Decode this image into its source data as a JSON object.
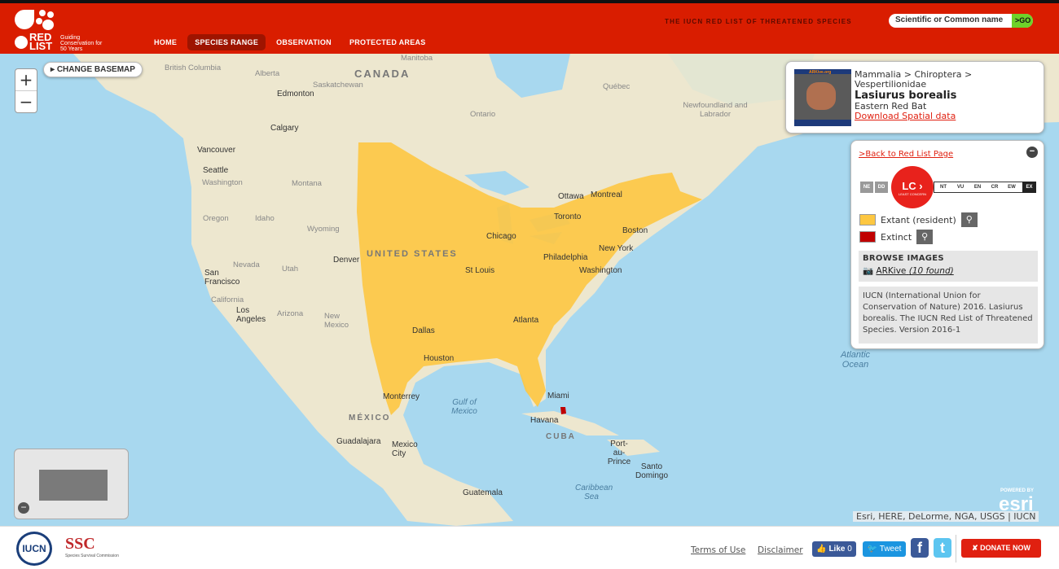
{
  "header": {
    "logo_text": "RED LIST",
    "logo_tagline": "Guiding Conservation for 50 Years",
    "nav": [
      {
        "label": "HOME"
      },
      {
        "label": "SPECIES RANGE",
        "active": true
      },
      {
        "label": "OBSERVATION"
      },
      {
        "label": "PROTECTED AREAS"
      }
    ],
    "tagline": "THE IUCN RED LIST OF THREATENED SPECIES",
    "search": {
      "placeholder": "Scientific or Common name",
      "go": ">GO"
    }
  },
  "map": {
    "change_basemap": "CHANGE BASEMAP",
    "zoom_in": "+",
    "zoom_out": "−",
    "range_color": "#fdc741",
    "extinct_color": "#c00000",
    "ocean_color": "#a8d8ef",
    "land_color": "#ede7cf",
    "labels": [
      "CANADA",
      "UNITED STATES",
      "MÉXICO",
      "CUBA",
      "British Columbia",
      "Alberta",
      "Saskatchewan",
      "Manitoba",
      "Ontario",
      "Québec",
      "Newfoundland and Labrador",
      "Edmonton",
      "Calgary",
      "Vancouver",
      "Seattle",
      "Washington",
      "Montana",
      "Oregon",
      "Idaho",
      "Wyoming",
      "Nevada",
      "Utah",
      "Denver",
      "San Francisco",
      "California",
      "Los Angeles",
      "Arizona",
      "New Mexico",
      "Dallas",
      "Houston",
      "Monterrey",
      "Guadalajara",
      "Mexico City",
      "Havana",
      "Miami",
      "Atlanta",
      "St Louis",
      "Chicago",
      "Ottawa",
      "Montreal",
      "Toronto",
      "Boston",
      "New York",
      "Philadelphia",
      "Washington",
      "Gulf of Mexico",
      "Atlantic Ocean",
      "Caribbean Sea",
      "Port-au-Prince",
      "Santo Domingo",
      "Guatemala"
    ],
    "attribution": "Esri, HERE, DeLorme, NGA, USGS | IUCN",
    "powered_by": "POWERED BY",
    "esri": "esri"
  },
  "species": {
    "taxonomy": "Mammalia > Chiroptera > Vespertilionidae",
    "scientific_name": "Lasiurus borealis",
    "common_name": "Eastern Red Bat",
    "download": "Download Spatial data",
    "photo_credit": "ARKive.org"
  },
  "legend": {
    "back": ">Back to Red List Page",
    "categories": [
      "NE",
      "DD",
      "LC",
      "NT",
      "VU",
      "EN",
      "CR",
      "EW",
      "EX"
    ],
    "status": {
      "code": "LC",
      "label": "LEAST CONCERN"
    },
    "items": [
      {
        "label": "Extant (resident)",
        "color": "#fdc741"
      },
      {
        "label": "Extinct",
        "color": "#c00000"
      }
    ],
    "browse_title": "BROWSE IMAGES",
    "browse_source": "ARKive",
    "browse_count": "(10 found)",
    "citation": "IUCN (International Union for Conservation of Nature) 2016. Lasiurus borealis. The IUCN Red List of Threatened Species. Version 2016-1"
  },
  "footer": {
    "iucn": "IUCN",
    "ssc": "SSC",
    "ssc_sub": "Species Survival Commission",
    "terms": "Terms of Use",
    "disclaimer": "Disclaimer",
    "like": "Like",
    "like_count": "0",
    "tweet": "Tweet",
    "facebook": "f",
    "twitter": "t",
    "donate": "DONATE NOW"
  }
}
